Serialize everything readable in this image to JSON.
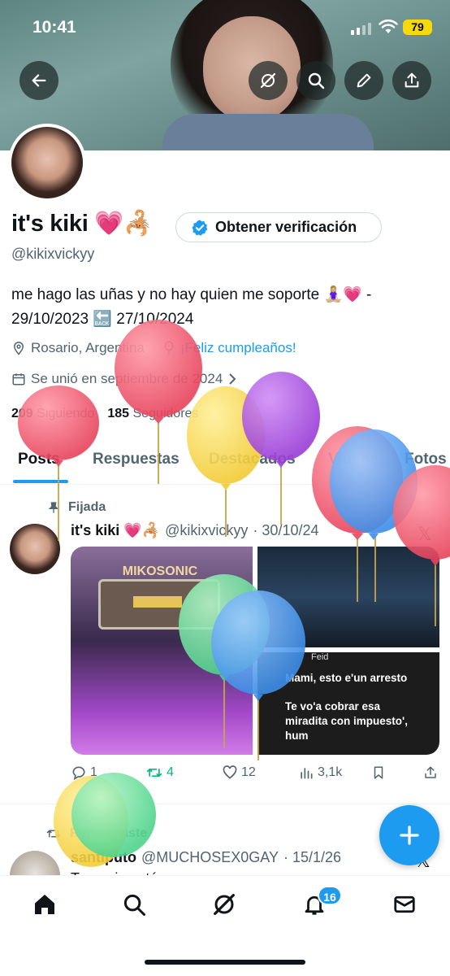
{
  "status_bar": {
    "time": "10:41",
    "battery": "79"
  },
  "profile": {
    "name": "it's kiki 💗🦂",
    "verify_label": "Obtener verificación",
    "handle": "@kikixvickyy",
    "bio_line1": "me hago las uñas y no hay quien me soporte 🧘🏼‍♀️💗 -",
    "bio_line2": "29/10/2023 🔙 27/10/2024",
    "location": "Rosario, Argentina",
    "birthday": "¡Feliz cumpleaños!",
    "joined": "Se unió en septiembre de 2024",
    "following_count": "209",
    "following_label": "Siguiendo",
    "followers_count": "185",
    "followers_label": "Seguidores"
  },
  "tabs": [
    "Posts",
    "Respuestas",
    "Destacados",
    "Videos",
    "Fotos"
  ],
  "pinned_post": {
    "pinned_label": "Fijada",
    "name": "it's kiki 💗🦂",
    "handle": "@kikixvickyy",
    "date": "· 30/10/24",
    "media": {
      "sign": "MIKOSONIC",
      "feid": "Feid",
      "quote1": "Mami, esto e'un arresto",
      "quote2": "Te vo'a cobrar esa miradita con impuesto', hum"
    },
    "replies": "1",
    "retweets": "4",
    "likes": "12",
    "views": "3,1k"
  },
  "second_post": {
    "reposted_label": "Reposteaste",
    "name": "santiputo",
    "handle": "@MUCHOSEX0GAY",
    "date": "· 15/1/26",
    "text": "Tu novio está..."
  },
  "nav": {
    "notifications_badge": "16"
  },
  "colors": {
    "accent": "#1d9bf0",
    "retweet": "#00ba7c"
  }
}
